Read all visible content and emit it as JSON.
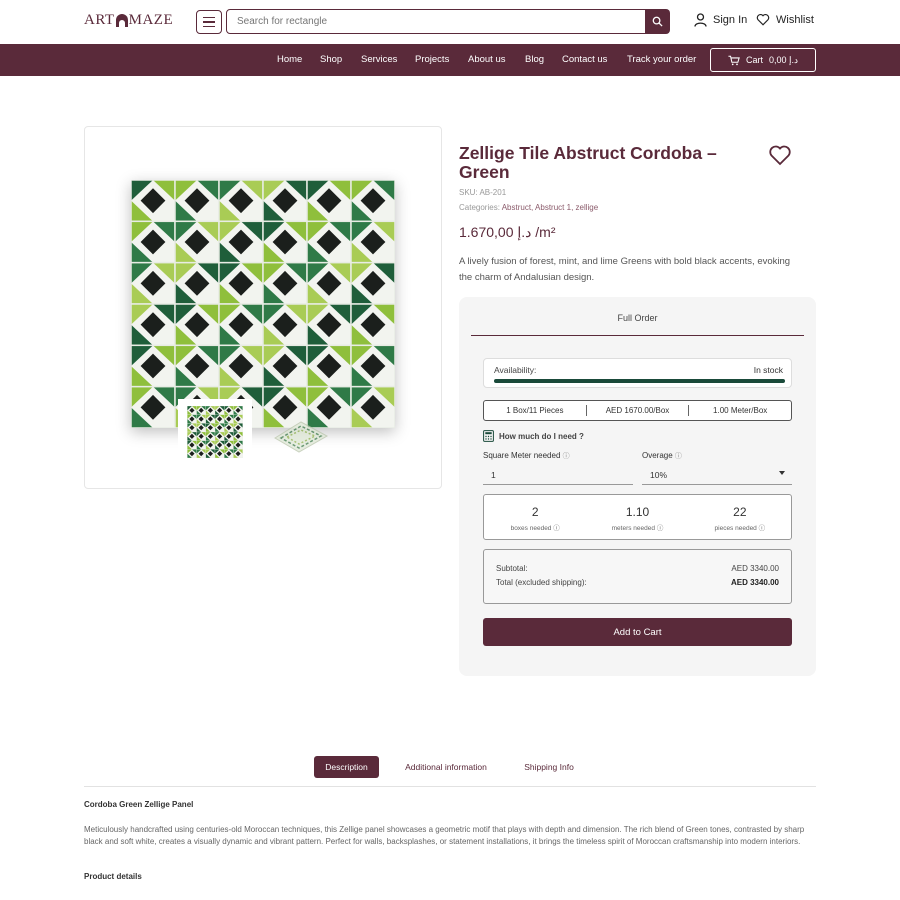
{
  "header": {
    "logo_left": "ART",
    "logo_right": "MAZE",
    "search_placeholder": "Search for rectangle",
    "sign_in": "Sign In",
    "wishlist": "Wishlist"
  },
  "nav": {
    "items": [
      "Home",
      "Shop",
      "Services",
      "Projects",
      "About us",
      "Blog",
      "Contact us",
      "Track your order"
    ],
    "cart_label": "Cart",
    "cart_amount": "د.إ 0,00"
  },
  "product": {
    "title": "Zellige Tile Abstruct Cordoba – Green",
    "sku_label": "SKU:",
    "sku": "AB-201",
    "categories_label": "Categories:",
    "categories": "Abstruct, Abstruct 1, zellige",
    "price": "د.إ 1.670,00 /m²",
    "description": "A lively fusion of forest, mint, and lime Greens with bold black accents, evoking the charm of Andalusian design."
  },
  "calculator": {
    "tab": "Full Order",
    "availability_label": "Availability:",
    "availability_value": "In stock",
    "availability_fraction": 1.0,
    "pack": {
      "box": "1 Box/11 Pieces",
      "price": "AED 1670.00/Box",
      "meter": "1.00 Meter/Box"
    },
    "how_much": "How much do I need ?",
    "sqm_label": "Square Meter needed",
    "sqm_value": "1",
    "overage_label": "Overage",
    "overage_value": "10%",
    "results": [
      {
        "value": "2",
        "caption": "boxes needed"
      },
      {
        "value": "1.10",
        "caption": "meters needed"
      },
      {
        "value": "22",
        "caption": "pieces needed"
      }
    ],
    "subtotal_label": "Subtotal:",
    "subtotal_value": "AED 3340.00",
    "total_label": "Total (excluded shipping):",
    "total_value": "AED 3340.00",
    "add_to_cart": "Add to Cart"
  },
  "tabs": {
    "description": "Description",
    "additional": "Additional information",
    "shipping": "Shipping Info"
  },
  "details": {
    "heading": "Cordoba Green Zellige Panel",
    "body": "Meticulously handcrafted using centuries-old Moroccan techniques, this Zellige panel showcases a geometric motif that plays with depth and dimension. The rich blend of Green tones, contrasted by sharp black and soft white, creates a visually dynamic and vibrant pattern. Perfect for walls, backsplashes, or statement installations, it brings the timeless spirit of Moroccan craftsmanship into modern interiors.",
    "product_details_heading": "Product details"
  },
  "colors": {
    "brand": "#5a2a3a",
    "stock_bar": "#1a4a3a"
  }
}
